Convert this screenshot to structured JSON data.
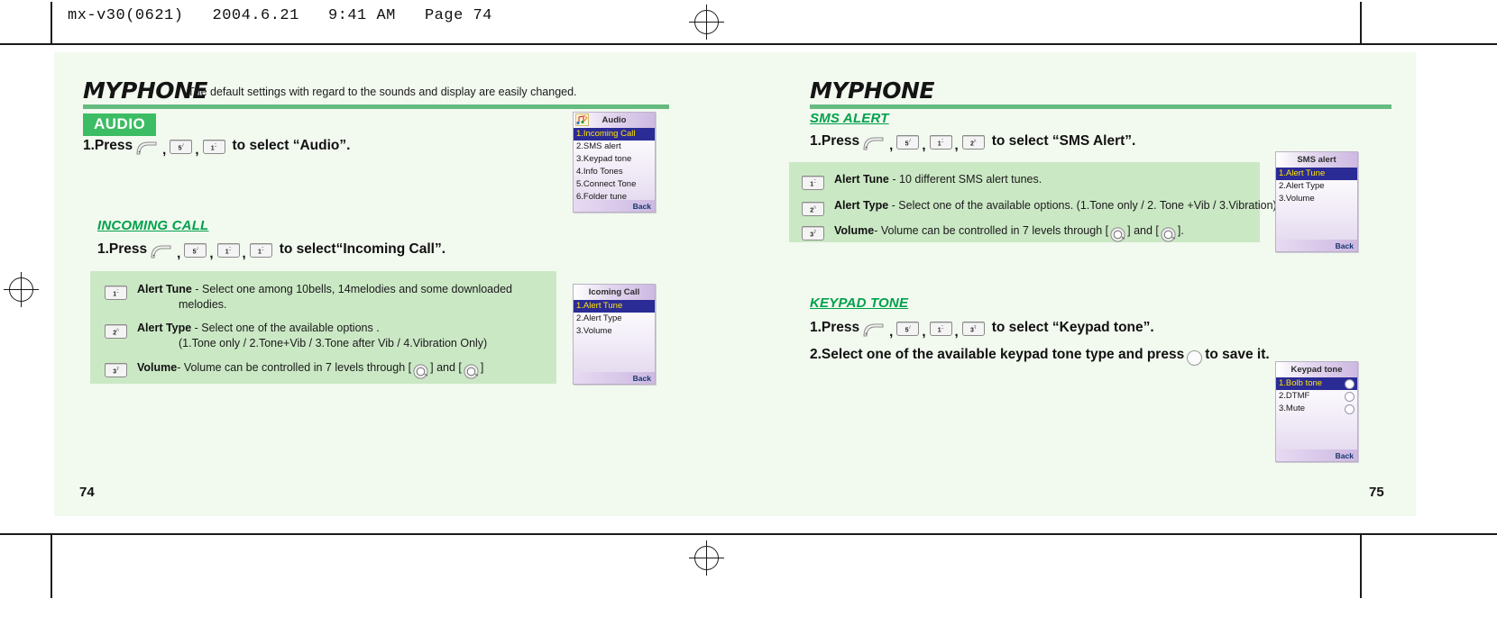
{
  "print_header": "mx-v30(0621)   2004.6.21   9:41 AM   Page 74",
  "left_page": {
    "brand": "MYPHONE",
    "brand_subtitle": "The default settings with regard to the sounds and display are easily changed.",
    "page_number": "74",
    "audio": {
      "tag": "AUDIO",
      "step1_prefix": "1.Press",
      "keys": [
        "menu-key",
        "5",
        "1"
      ],
      "step1_suffix": "to select “Audio”.",
      "screen": {
        "title": "Audio",
        "items": [
          "1.Incoming Call",
          "2.SMS alert",
          "3.Keypad tone",
          "4.Info Tones",
          "5.Connect Tone",
          "6.Folder tune"
        ],
        "selected_index": 0,
        "softkey": "Back"
      }
    },
    "incoming_call": {
      "heading": "INCOMING CALL",
      "step1_prefix": "1.Press",
      "keys": [
        "menu-key",
        "5",
        "1",
        "1"
      ],
      "step1_suffix": "to select“Incoming Call”.",
      "rows": [
        {
          "key": "1",
          "label": "Alert Tune",
          "text": " - Select one among 10bells, 14melodies and some downloaded",
          "text2": "melodies."
        },
        {
          "key": "2",
          "label": "Alert Type",
          "text": " - Select one of the available options .",
          "text2": "(1.Tone only / 2.Tone+Vib / 3.Tone after Vib / 4.Vibration Only)"
        },
        {
          "key": "3",
          "label": "Volume",
          "text_a": " - Volume can be controlled in 7 levels through [ ",
          "text_b": " ] and [ ",
          "text_c": " ]"
        }
      ],
      "screen": {
        "title": "Icoming Call",
        "items": [
          "1.Alert Tune",
          "2.Alert Type",
          "3.Volume"
        ],
        "selected_index": 0,
        "softkey": "Back"
      }
    }
  },
  "right_page": {
    "brand": "MYPHONE",
    "page_number": "75",
    "sms_alert": {
      "heading": "SMS ALERT",
      "step1_prefix": "1.Press",
      "keys": [
        "menu-key",
        "5",
        "1",
        "2"
      ],
      "step1_suffix": "to select “SMS Alert”.",
      "rows": [
        {
          "key": "1",
          "label": "Alert Tune",
          "text": " - 10 different SMS alert tunes."
        },
        {
          "key": "2",
          "label": "Alert Type",
          "text": " - Select one of the available options. (1.Tone only / 2. Tone +Vib / 3.Vibration)"
        },
        {
          "key": "3",
          "label": "Volume",
          "text_a": " - Volume can be controlled in 7 levels through [ ",
          "text_b": " ] and [ ",
          "text_c": " ]."
        }
      ],
      "screen": {
        "title": "SMS alert",
        "items": [
          "1.Alert Tune",
          "2.Alert Type",
          "3.Volume"
        ],
        "selected_index": 0,
        "softkey": "Back"
      }
    },
    "keypad_tone": {
      "heading": "KEYPAD TONE",
      "step1_prefix": "1.Press",
      "keys": [
        "menu-key",
        "5",
        "1",
        "3"
      ],
      "step1_suffix": "to select “Keypad tone”.",
      "step2_prefix": "2.Select one of the available keypad tone type and press",
      "step2_suffix": "to save it.",
      "screen": {
        "title": "Keypad tone",
        "items": [
          "1.Bolb tone",
          "2.DTMF",
          "3.Mute"
        ],
        "selected_index": 0,
        "softkey": "Back"
      }
    }
  },
  "colors": {
    "page_bg": "#f2f9ef",
    "green_accent": "#3cbc63",
    "link_green": "#00a14b",
    "info_box": "#cbe8c5",
    "screen_select": "#2b2b96",
    "screen_select_text": "#ffe400"
  }
}
